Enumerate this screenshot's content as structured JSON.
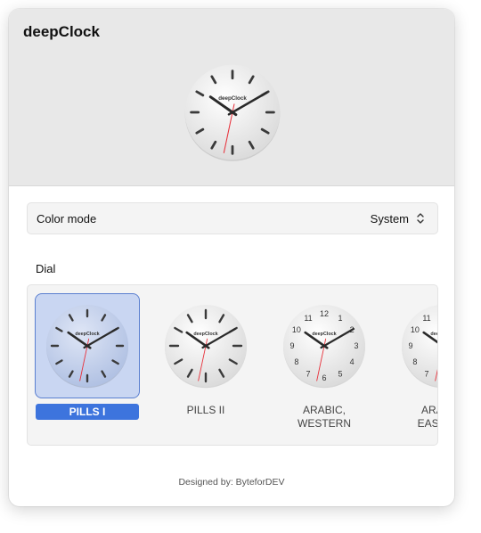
{
  "app": {
    "title": "deepClock"
  },
  "clock_face": {
    "brand": "deepClock",
    "hour": 10,
    "minute": 10,
    "second": 32
  },
  "color_mode": {
    "label": "Color mode",
    "value": "System"
  },
  "dial": {
    "title": "Dial",
    "options": [
      {
        "label": "PILLS I",
        "style": "pills",
        "selected": true
      },
      {
        "label": "PILLS II",
        "style": "pills2",
        "selected": false
      },
      {
        "label": "ARABIC,\nWESTERN",
        "style": "arabic",
        "selected": false
      },
      {
        "label": "ARABIC,\nEASTERN",
        "style": "arabic",
        "selected": false
      }
    ]
  },
  "numerals": [
    "12",
    "1",
    "2",
    "3",
    "4",
    "5",
    "6",
    "7",
    "8",
    "9",
    "10",
    "11"
  ],
  "colors": {
    "accent": "#3d74dd",
    "second_hand": "#e8323c",
    "selected_bg": "#c9d6f2"
  },
  "footer": {
    "text": "Designed by: ByteforDEV"
  }
}
